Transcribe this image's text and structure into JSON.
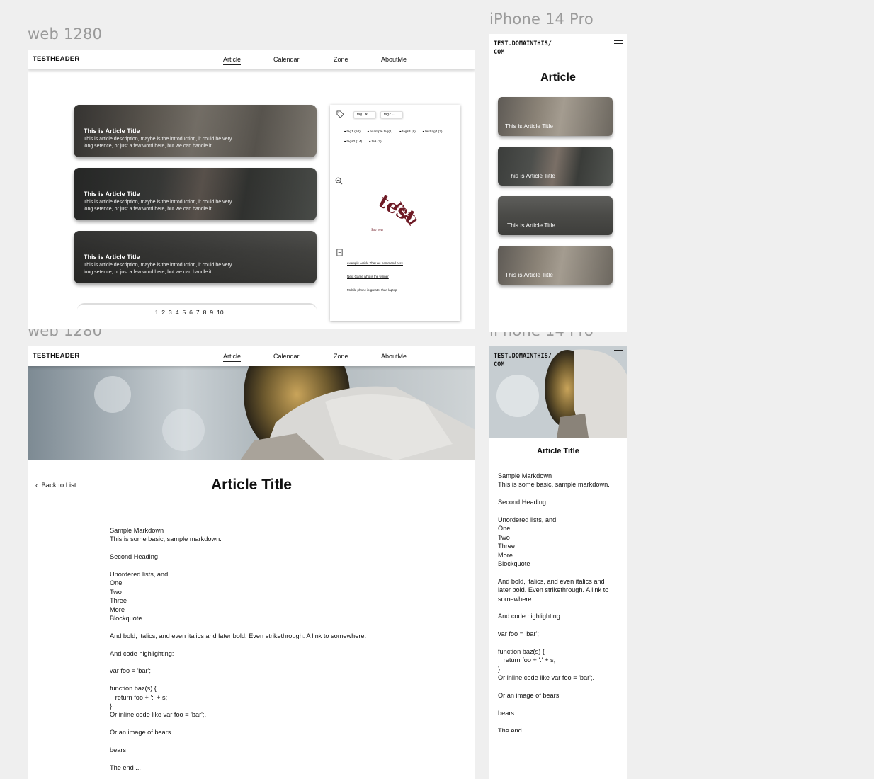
{
  "frames": {
    "web_list_label": "web 1280",
    "iphone_list_label": "iPhone 14 Pro",
    "web_article_label": "web 1280",
    "iphone_article_label": "iPhone 14 Pro"
  },
  "header": {
    "brand": "TESTHEADER",
    "nav": [
      "Article",
      "Calendar",
      "Zone",
      "AboutMe"
    ]
  },
  "cards": [
    {
      "title": "This is Article Title",
      "desc": "This is article description, maybe is the introduction, it could be very long setence, or just a few word here, but we can handle it"
    },
    {
      "title": "This is Article Title",
      "desc": "This is article description, maybe is the introduction, it could be very long setence, or just a few word here, but we can handle it"
    },
    {
      "title": "This is Article Title",
      "desc": "This is article description, maybe is the introduction, it could be very long setence, or just a few word here, but we can handle it"
    }
  ],
  "pagination": [
    "1",
    "2",
    "3",
    "4",
    "5",
    "6",
    "7",
    "8",
    "9",
    "10"
  ],
  "sidebar": {
    "chips": [
      "tag1",
      "tag2"
    ],
    "tags_row1": [
      "tag1 (10)",
      "example tag(1)",
      "tags3 (8)",
      "testtag4 (2)"
    ],
    "tags_row2": [
      "tags2 (14)",
      "ta9 (2)"
    ],
    "links": [
      "example Article That we command here",
      "Next Game who is the winner",
      "Mobile phone is greater than laptop"
    ]
  },
  "mobile": {
    "domain_line1": "TEST.DOMAINTHIS/",
    "domain_line2": "COM",
    "list_title": "Article",
    "card_title": "This is Article Title",
    "article_title": "Article Title"
  },
  "article": {
    "back": "Back to List",
    "title": "Article Title",
    "lines": {
      "l1": "Sample Markdown",
      "l2": "This is some basic, sample markdown.",
      "l3": "Second Heading",
      "l4": "Unordered lists, and:",
      "l5": "One",
      "l6": "Two",
      "l7": "Three",
      "l8": "More",
      "l9": "Blockquote",
      "l10": "And bold, italics, and even italics and later bold. Even strikethrough. A link to somewhere.",
      "l11": "And code highlighting:",
      "l12": "var foo = 'bar';",
      "l13": "function baz(s) {",
      "l14": "   return foo + ':' + s;",
      "l15": "}",
      "l16": "Or inline code like var foo = 'bar';.",
      "l17": "Or an image of bears",
      "l18": "bears",
      "l19": "The end ..."
    }
  }
}
